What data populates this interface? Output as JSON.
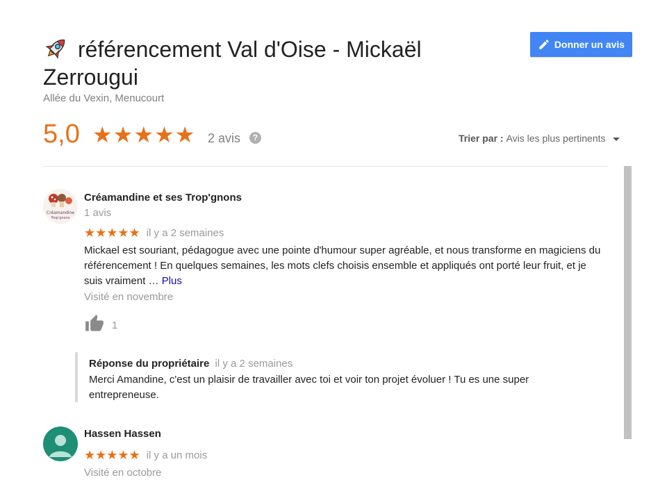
{
  "header": {
    "title": "référencement Val d'Oise - Mickaël Zerrougui",
    "address": "Allée du Vexin, Menucourt",
    "write_review_label": "Donner un avis"
  },
  "summary": {
    "rating": "5,0",
    "stars": "★★★★★",
    "review_count": "2 avis",
    "help_icon": "?"
  },
  "sort": {
    "label": "Trier par :",
    "value": "Avis les plus pertinents"
  },
  "reviews": [
    {
      "author": "Créamandine et ses Trop'gnons",
      "author_reviews": "1 avis",
      "stars": "★★★★★",
      "rating_value": 5,
      "time": "il y a 2 semaines",
      "text": "Mickael est souriant, pédagogue avec une pointe d'humour super agréable, et nous transforme en magiciens du référencement ! En quelques semaines, les mots clefs choisis ensemble et appliqués ont porté leur fruit, et je suis vraiment …",
      "more_label": "Plus",
      "visited": "Visité en novembre",
      "likes": "1",
      "owner_reply": {
        "label": "Réponse du propriétaire",
        "time": "il y a 2 semaines",
        "text": "Merci Amandine, c'est un plaisir de travailler avec toi et voir ton projet évoluer ! Tu es une super entrepreneuse."
      }
    },
    {
      "author": "Hassen Hassen",
      "stars": "★★★★★",
      "rating_value": 5,
      "time": "il y a un mois",
      "visited": "Visité en octobre"
    }
  ],
  "colors": {
    "accent": "#e7711b",
    "button": "#4285f4",
    "link": "#1a0dab",
    "avatar2_bg": "#1e8e75"
  },
  "icons": [
    "rocket-icon",
    "pencil-icon",
    "help-icon",
    "sort-caret-icon",
    "thumbs-up-icon",
    "person-avatar-icon"
  ]
}
